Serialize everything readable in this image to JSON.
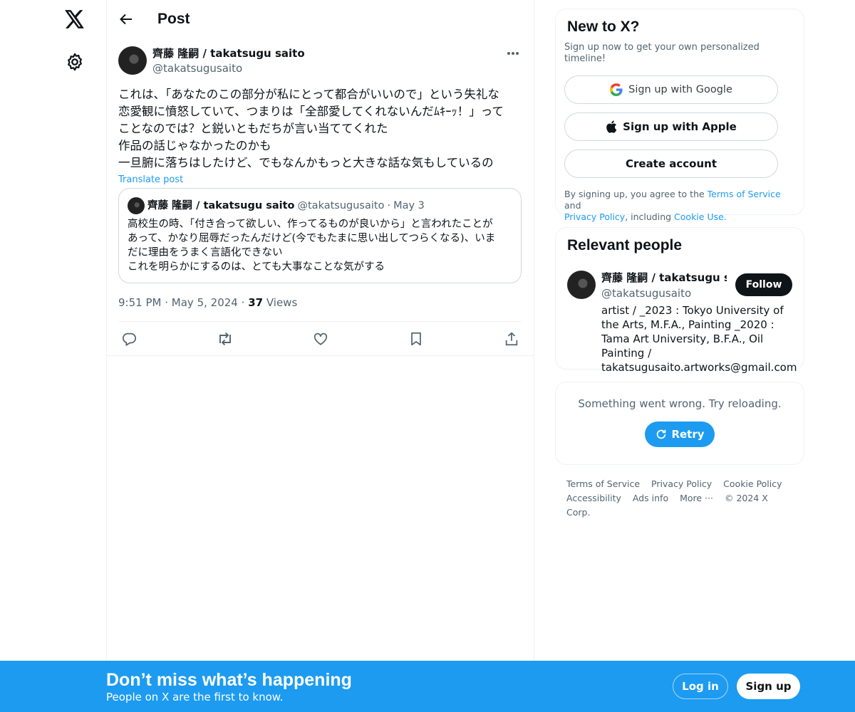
{
  "header": {
    "title": "Post"
  },
  "post": {
    "author_name": "齊藤 隆嗣 / takatsugu saito",
    "author_handle": "@takatsugusaito",
    "text": "これは、「あなたのこの部分が私にとって都合がいいので」という失礼な\n恋愛観に憤怒していて、つまりは「全部愛してくれないんだﾑｷｰｯ！」って\nことなのでは？と鋭いともだちが言い当ててくれた\n作品の話じゃなかったのかも\n一旦腑に落ちはしたけど、でもなんかもっと大きな話な気もしているの",
    "translate_label": "Translate post",
    "quote": {
      "author_name": "齊藤 隆嗣 / takatsugu saito",
      "author_handle": "@takatsugusaito",
      "dot": "·",
      "date": "May 3",
      "text": "高校生の時、「付き合って欲しい、作ってるものが良いから」と言われたことが\nあって、かなり屈辱だったんだけど(今でもたまに思い出してつらくなる)、いま\nだに理由をうまく言語化できない\nこれを明らかにするのは、とても大事なことな気がする"
    },
    "time": "9:51 PM",
    "sep": "·",
    "date": "May 5, 2024",
    "views_count": "37",
    "views_label": "Views"
  },
  "sidebar_new": {
    "title": "New to X?",
    "subtitle": "Sign up now to get your own personalized timeline!",
    "google_label": "Sign up with Google",
    "apple_label": "Sign up with Apple",
    "create_label": "Create account",
    "terms_prefix": "By signing up, you agree to the ",
    "terms_link": "Terms of Service",
    "terms_and": " and",
    "privacy_link": "Privacy Policy",
    "terms_including": ", including ",
    "cookie_link": "Cookie Use."
  },
  "relevant": {
    "title": "Relevant people",
    "name": "齊藤 隆嗣 / takatsugu saito",
    "handle": "@takatsugusaito",
    "bio": "artist / _2023 : Tokyo University of the Arts, M.F.A., Painting _2020 : Tama Art University, B.F.A., Oil Painting / takatsugusaito.artworks@gmail.com",
    "follow_label": "Follow"
  },
  "error": {
    "message": "Something went wrong. Try reloading.",
    "retry_label": "Retry"
  },
  "footer": {
    "terms": "Terms of Service",
    "privacy": "Privacy Policy",
    "cookie": "Cookie Policy",
    "accessibility": "Accessibility",
    "ads": "Ads info",
    "more": "More ···",
    "copyright": "© 2024 X Corp."
  },
  "banner": {
    "title": "Don’t miss what’s happening",
    "subtitle": "People on X are the first to know.",
    "login_label": "Log in",
    "signup_label": "Sign up"
  },
  "colors": {
    "accent": "#1d9bf0",
    "text": "#0f1419",
    "secondary": "#536471"
  }
}
